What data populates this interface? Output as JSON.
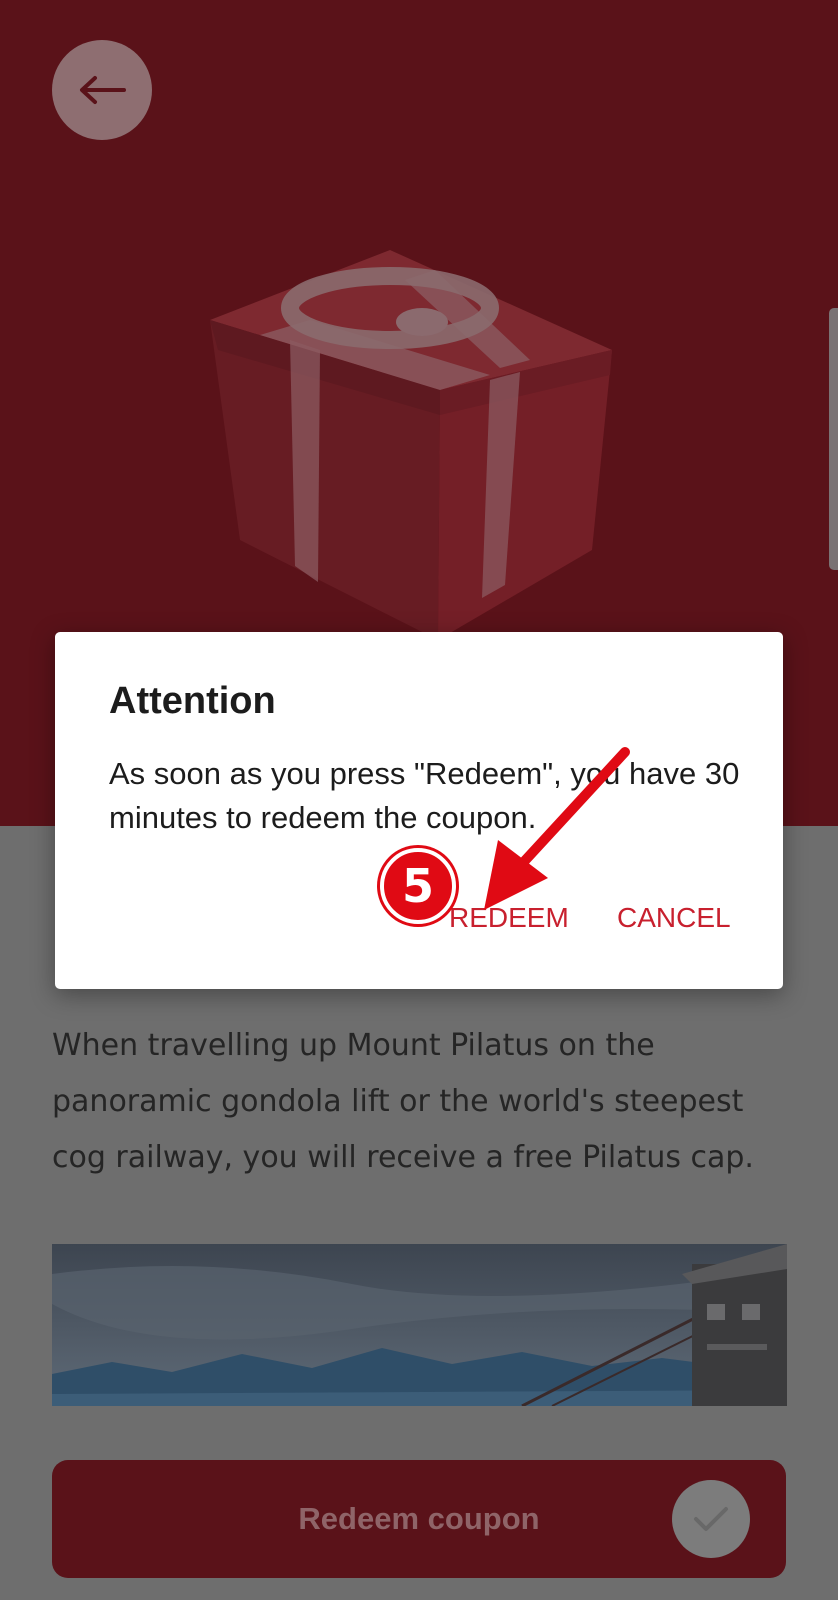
{
  "header": {
    "back_icon": "arrow-left-icon"
  },
  "hero": {
    "image": "gift-box",
    "background": "#5a1219"
  },
  "content": {
    "description": "When travelling up Mount Pilatus on the panoramic gondola lift or the world's steepest cog railway, you will receive a free Pilatus cap.",
    "image": "mountain-gondola-photo"
  },
  "redeem_bar": {
    "label": "Redeem coupon",
    "icon": "check-icon"
  },
  "dialog": {
    "title": "Attention",
    "message": "As soon as you press \"Redeem\", you have 30 minutes to redeem the coupon.",
    "confirm_label": "REDEEM",
    "cancel_label": "CANCEL"
  },
  "annotation": {
    "step": "5",
    "color": "#e00a14"
  }
}
